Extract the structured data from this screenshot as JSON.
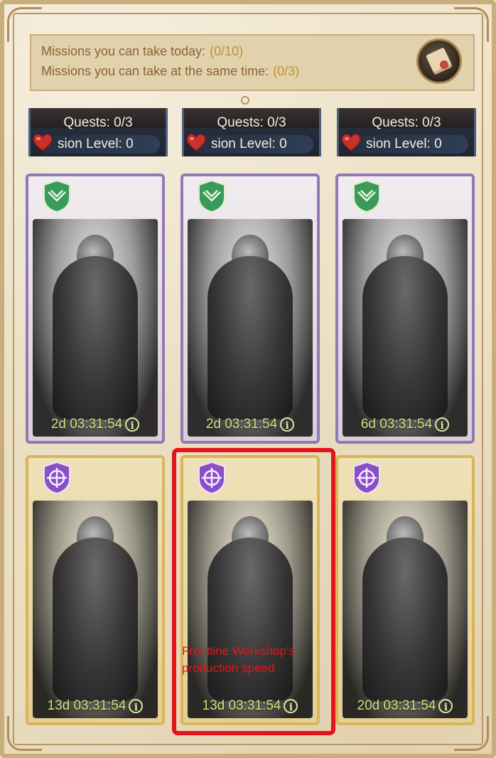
{
  "missions": {
    "today_label": "Missions you can take today:",
    "today_value": "(0/10)",
    "concurrent_label": "Missions you can take at the same time:",
    "concurrent_value": "(0/3)"
  },
  "top_cards": [
    {
      "quests": "Quests: 0/3",
      "level": "sion Level: 0"
    },
    {
      "quests": "Quests: 0/3",
      "level": "sion Level: 0"
    },
    {
      "quests": "Quests: 0/3",
      "level": "sion Level: 0"
    }
  ],
  "hero_cards": [
    {
      "timer": "2d 03:31:54",
      "rarity": "purple",
      "badge": "shield-wings-icon"
    },
    {
      "timer": "2d 03:31:54",
      "rarity": "purple",
      "badge": "shield-wings-icon"
    },
    {
      "timer": "6d 03:31:54",
      "rarity": "purple",
      "badge": "shield-wings-icon"
    },
    {
      "timer": "13d 03:31:54",
      "rarity": "gold",
      "badge": "crosshair-emblem-icon"
    },
    {
      "timer": "13d 03:31:54",
      "rarity": "gold",
      "badge": "crosshair-emblem-icon"
    },
    {
      "timer": "20d 03:31:54",
      "rarity": "gold",
      "badge": "crosshair-emblem-icon"
    }
  ],
  "overlay": {
    "text": "Frontline Workshop's production speed"
  },
  "colors": {
    "highlight": "#e3151b",
    "timer": "#c9e37a",
    "purple_border": "#9478b6",
    "gold_border": "#d9b55a"
  }
}
